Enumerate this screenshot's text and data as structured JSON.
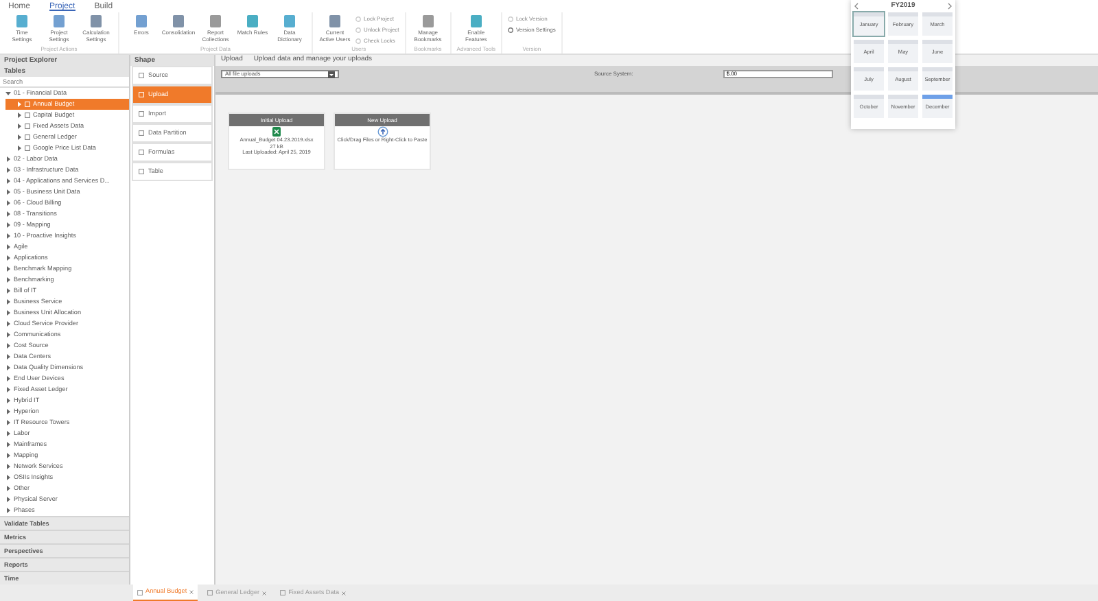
{
  "ribbon_tabs": [
    {
      "label": "Home",
      "selected": false
    },
    {
      "label": "Project",
      "selected": true
    },
    {
      "label": "Build",
      "selected": false
    }
  ],
  "ribbon_groups": [
    {
      "label": "Project Actions",
      "buttons": [
        {
          "label": "Time Settings",
          "kind": "large",
          "disabled": false
        },
        {
          "label": "Project Settings",
          "kind": "large",
          "disabled": false
        },
        {
          "label": "Calculation Settings",
          "kind": "large",
          "disabled": false
        }
      ]
    },
    {
      "label": "Project Data",
      "buttons": [
        {
          "label": "Errors",
          "kind": "large",
          "disabled": false
        },
        {
          "label": "Consolidation",
          "kind": "large",
          "disabled": false
        },
        {
          "label": "Report Collections",
          "kind": "large",
          "disabled": false
        },
        {
          "label": "Match Rules",
          "kind": "large",
          "disabled": false
        },
        {
          "label": "Data Dictionary",
          "kind": "large",
          "disabled": false
        }
      ]
    },
    {
      "label": "Users",
      "buttons": [
        {
          "label": "Current Active Users",
          "kind": "large",
          "disabled": false
        },
        {
          "label": "Lock Project",
          "kind": "small",
          "disabled": true
        },
        {
          "label": "Unlock Project",
          "kind": "small",
          "disabled": true
        },
        {
          "label": "Check Locks",
          "kind": "small",
          "disabled": true
        }
      ]
    },
    {
      "label": "Bookmarks",
      "buttons": [
        {
          "label": "Manage Bookmarks",
          "kind": "large",
          "disabled": false
        }
      ]
    },
    {
      "label": "Advanced Tools",
      "buttons": [
        {
          "label": "Enable Features",
          "kind": "large",
          "disabled": false
        }
      ]
    },
    {
      "label": "Version",
      "buttons": [
        {
          "label": "Lock Version",
          "kind": "small",
          "disabled": true
        },
        {
          "label": "Version Settings",
          "kind": "small",
          "disabled": false
        }
      ]
    }
  ],
  "explorer": {
    "title": "Project Explorer",
    "section": "Tables",
    "search": {
      "placeholder": "Search"
    },
    "tree": [
      {
        "label": "01 - Financial Data",
        "expanded": true,
        "selected": false,
        "children": [
          {
            "label": "Annual Budget",
            "expanded": false,
            "selected": true
          },
          {
            "label": "Capital Budget",
            "expanded": false,
            "selected": false
          },
          {
            "label": "Fixed Assets Data",
            "expanded": false,
            "selected": false
          },
          {
            "label": "General Ledger",
            "expanded": false,
            "selected": false
          },
          {
            "label": "Google Price List Data",
            "expanded": false,
            "selected": false
          }
        ]
      },
      {
        "label": "02 - Labor Data",
        "expanded": false,
        "selected": false
      },
      {
        "label": "03 - Infrastructure Data",
        "expanded": false,
        "selected": false
      },
      {
        "label": "04 - Applications and Services D...",
        "expanded": false,
        "selected": false
      },
      {
        "label": "05 - Business Unit Data",
        "expanded": false,
        "selected": false
      },
      {
        "label": "06 - Cloud Billing",
        "expanded": false,
        "selected": false
      },
      {
        "label": "08 - Transitions",
        "expanded": false,
        "selected": false
      },
      {
        "label": "09 - Mapping",
        "expanded": false,
        "selected": false
      },
      {
        "label": "10 - Proactive Insights",
        "expanded": false,
        "selected": false
      },
      {
        "label": "Agile",
        "expanded": false,
        "selected": false
      },
      {
        "label": "Applications",
        "expanded": false,
        "selected": false
      },
      {
        "label": "Benchmark Mapping",
        "expanded": false,
        "selected": false
      },
      {
        "label": "Benchmarking",
        "expanded": false,
        "selected": false
      },
      {
        "label": "Bill of IT",
        "expanded": false,
        "selected": false
      },
      {
        "label": "Business Service",
        "expanded": false,
        "selected": false
      },
      {
        "label": "Business Unit Allocation",
        "expanded": false,
        "selected": false
      },
      {
        "label": "Cloud Service Provider",
        "expanded": false,
        "selected": false
      },
      {
        "label": "Communications",
        "expanded": false,
        "selected": false
      },
      {
        "label": "Cost Source",
        "expanded": false,
        "selected": false
      },
      {
        "label": "Data Centers",
        "expanded": false,
        "selected": false
      },
      {
        "label": "Data Quality Dimensions",
        "expanded": false,
        "selected": false
      },
      {
        "label": "End User Devices",
        "expanded": false,
        "selected": false
      },
      {
        "label": "Fixed Asset Ledger",
        "expanded": false,
        "selected": false
      },
      {
        "label": "Hybrid IT",
        "expanded": false,
        "selected": false
      },
      {
        "label": "Hyperion",
        "expanded": false,
        "selected": false
      },
      {
        "label": "IT Resource Towers",
        "expanded": false,
        "selected": false
      },
      {
        "label": "Labor",
        "expanded": false,
        "selected": false
      },
      {
        "label": "Mainframes",
        "expanded": false,
        "selected": false
      },
      {
        "label": "Mapping",
        "expanded": false,
        "selected": false
      },
      {
        "label": "Network Services",
        "expanded": false,
        "selected": false
      },
      {
        "label": "OSIIs Insights",
        "expanded": false,
        "selected": false
      },
      {
        "label": "Other",
        "expanded": false,
        "selected": false
      },
      {
        "label": "Physical Server",
        "expanded": false,
        "selected": false
      },
      {
        "label": "Phases",
        "expanded": false,
        "selected": false
      }
    ],
    "sections": [
      "Validate Tables",
      "Metrics",
      "Perspectives",
      "Reports",
      "Time"
    ]
  },
  "shape": {
    "title": "Shape",
    "steps": [
      {
        "label": "Source",
        "selected": false
      },
      {
        "label": "Upload",
        "selected": true
      },
      {
        "label": "Import",
        "selected": false
      },
      {
        "label": "Data Partition",
        "selected": false
      },
      {
        "label": "Formulas",
        "selected": false
      },
      {
        "label": "Table",
        "selected": false
      }
    ]
  },
  "upload": {
    "title": "Upload",
    "subtitle": "Upload data and manage your uploads",
    "filter": "All file uploads",
    "source_label": "Source System:",
    "source_value": "$.00",
    "cards": [
      {
        "kind": "file",
        "title": "Initial Upload",
        "lines": [
          "Annual_Budget 04.23.2019.xlsx",
          "27 kB",
          "Last Uploaded: April 25, 2019"
        ]
      },
      {
        "kind": "drop",
        "title": "New Upload",
        "lines": [
          "Click/Drag Files or Right-Click to Paste"
        ]
      }
    ]
  },
  "calendar": {
    "year": "FY2019",
    "months": [
      {
        "label": "January",
        "selected": false,
        "focused": true
      },
      {
        "label": "February",
        "selected": false,
        "focused": false
      },
      {
        "label": "March",
        "selected": false,
        "focused": false
      },
      {
        "label": "April",
        "selected": false,
        "focused": false
      },
      {
        "label": "May",
        "selected": false,
        "focused": false
      },
      {
        "label": "June",
        "selected": false,
        "focused": false
      },
      {
        "label": "July",
        "selected": false,
        "focused": false
      },
      {
        "label": "August",
        "selected": false,
        "focused": false
      },
      {
        "label": "September",
        "selected": false,
        "focused": false
      },
      {
        "label": "October",
        "selected": false,
        "focused": false
      },
      {
        "label": "November",
        "selected": false,
        "focused": false
      },
      {
        "label": "December",
        "selected": true,
        "focused": false
      }
    ]
  },
  "doc_tabs": [
    {
      "label": "Annual Budget",
      "selected": true
    },
    {
      "label": "General Ledger",
      "selected": false
    },
    {
      "label": "Fixed Assets Data",
      "selected": false
    }
  ]
}
